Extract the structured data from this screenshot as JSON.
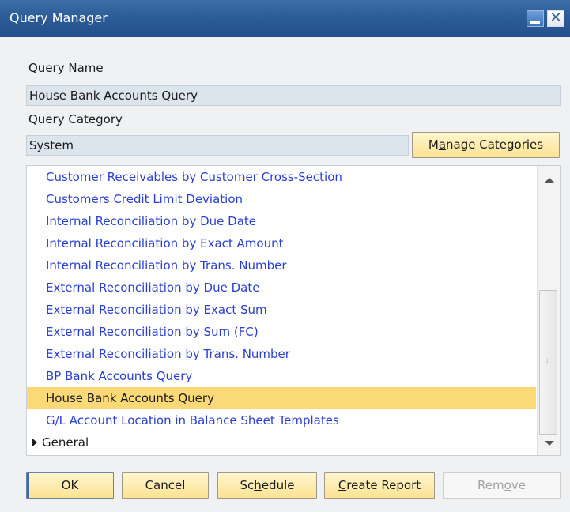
{
  "window": {
    "title": "Query Manager"
  },
  "form": {
    "query_name_label": "Query Name",
    "query_name_value": "House Bank Accounts Query",
    "query_category_label": "Query Category",
    "query_category_value": "System",
    "manage_categories": {
      "pre": "M",
      "mnemonic": "a",
      "post": "nage Categories"
    }
  },
  "list": {
    "items": [
      "Customer Receivables by Customer Cross-Section",
      "Customers Credit Limit Deviation",
      "Internal Reconciliation by Due Date",
      "Internal Reconciliation by Exact Amount",
      "Internal Reconciliation by Trans. Number",
      "External Reconciliation by Due Date",
      "External Reconciliation by Exact Sum",
      "External Reconciliation by Sum (FC)",
      "External Reconciliation by Trans. Number",
      "BP Bank Accounts Query",
      "House Bank Accounts Query",
      "G/L Account Location in Balance Sheet Templates"
    ],
    "selected": "House Bank Accounts Query",
    "category": "General"
  },
  "buttons": {
    "ok": "OK",
    "cancel": "Cancel",
    "schedule": {
      "pre": "Sc",
      "mnemonic": "h",
      "post": "edule"
    },
    "create_report": {
      "pre": "",
      "mnemonic": "C",
      "post": "reate Report"
    },
    "remove": {
      "pre": "Rem",
      "mnemonic": "o",
      "post": "ve"
    }
  },
  "colors": {
    "titlebar": "#2a5a96",
    "link": "#2a3fd0",
    "selection": "#fbd977",
    "button": "#fbe393"
  }
}
